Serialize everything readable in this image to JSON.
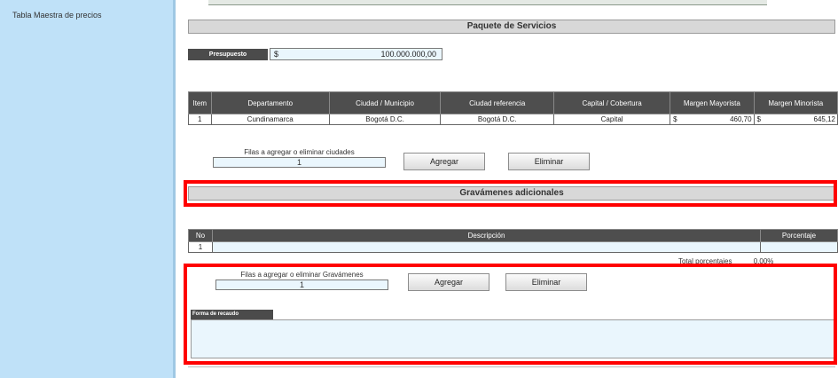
{
  "sidebar": {
    "items": [
      {
        "label": "Tabla Maestra de precios"
      }
    ]
  },
  "services": {
    "title": "Paquete de Servicios",
    "budget": {
      "label": "Presupuesto",
      "currency": "$",
      "value": "100.000.000,00"
    },
    "table": {
      "headers": [
        "Item",
        "Departamento",
        "Ciudad / Municipio",
        "Ciudad referencia",
        "Capital / Cobertura",
        "Margen Mayorista",
        "Margen Minorista"
      ],
      "rows": [
        {
          "item": "1",
          "departamento": "Cundinamarca",
          "ciudad": "Bogotá D.C.",
          "referencia": "Bogotá D.C.",
          "capital": "Capital",
          "mayorista_cur": "$",
          "mayorista": "460,70",
          "minorista_cur": "$",
          "minorista": "645,12"
        }
      ]
    },
    "rows_control": {
      "label": "Filas a agregar o eliminar ciudades",
      "value": "1"
    },
    "add_label": "Agregar",
    "remove_label": "Eliminar"
  },
  "taxes": {
    "title": "Gravámenes adicionales",
    "table": {
      "headers": [
        "No",
        "Descripción",
        "Porcentaje"
      ],
      "rows": [
        {
          "no": "1",
          "descripcion": "",
          "porcentaje": ""
        }
      ]
    },
    "total_label": "Total porcentajes",
    "total_value": "0,00%",
    "rows_control": {
      "label": "Filas a agregar o eliminar Gravámenes",
      "value": "1"
    },
    "add_label": "Agregar",
    "remove_label": "Eliminar"
  },
  "observations": {
    "label": "Forma de recaudo",
    "value": ""
  },
  "colors": {
    "sidebar": "#bfe1f8",
    "header_dark": "#4e4e4e",
    "input_bg": "#eaf6fd",
    "highlight": "#ff0000"
  }
}
